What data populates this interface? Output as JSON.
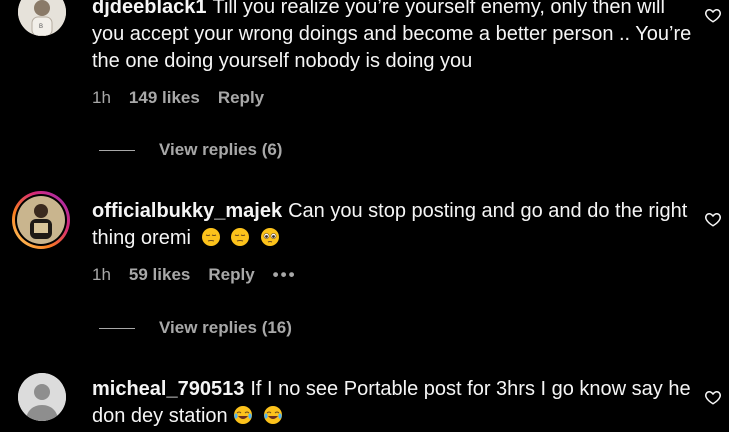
{
  "comments": [
    {
      "username": "djdeeblack1",
      "text": "Till you realize you’re yourself enemy, only then will you accept your wrong doings and become a better person .. You’re the one doing yourself nobody is doing you",
      "time": "1h",
      "likes": "149 likes",
      "reply": "Reply",
      "view_replies": "View replies (6)"
    },
    {
      "username": "officialbukky_majek",
      "text": "Can you stop posting and go and do the right thing oremi",
      "emojis": [
        "pensive-face",
        "pensive-face",
        "pleading-face"
      ],
      "time": "1h",
      "likes": "59 likes",
      "reply": "Reply",
      "more": "•••",
      "view_replies": "View replies (16)"
    },
    {
      "username": "micheal_790513",
      "text": "If I no see Portable post for 3hrs I go know say he don dey station",
      "emojis": [
        "tears-of-joy",
        "tears-of-joy"
      ]
    }
  ],
  "colors": {
    "background": "#000000",
    "text": "#f5f5f5",
    "muted": "#a8a8a8",
    "ring_start": "#feda75",
    "ring_end": "#c13584"
  }
}
